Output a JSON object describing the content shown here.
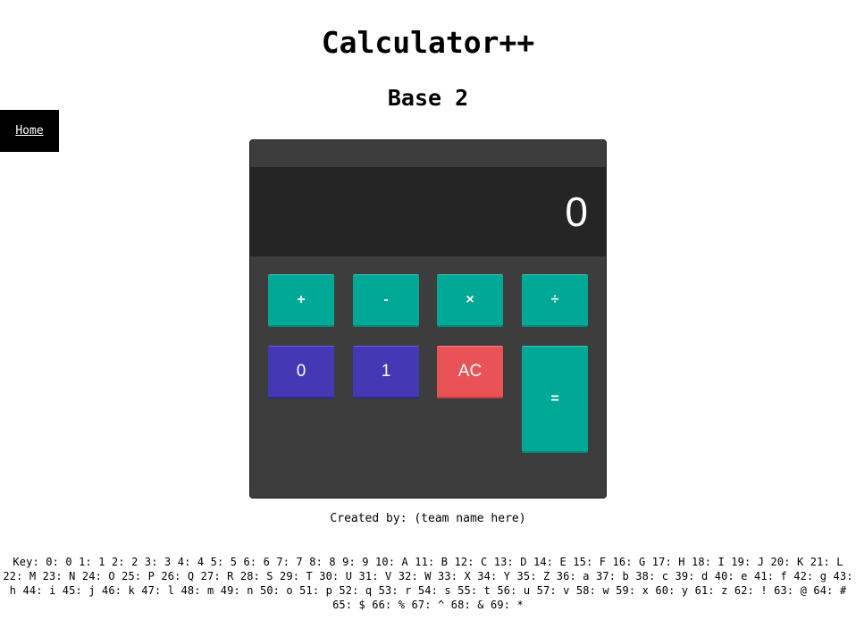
{
  "header": {
    "title": "Calculator++",
    "subtitle": "Base 2"
  },
  "nav": {
    "home_label": "Home"
  },
  "calculator": {
    "display_value": "0",
    "operators": {
      "add": "+",
      "subtract": "-",
      "multiply": "×",
      "divide": "÷"
    },
    "digits": {
      "zero": "0",
      "one": "1"
    },
    "clear_label": "AC",
    "equals_label": "=",
    "colors": {
      "body": "#3d3d3d",
      "display": "#252525",
      "operator": "#00a896",
      "digit": "#4438b5",
      "clear": "#e95357"
    }
  },
  "footer": {
    "credit": "Created by: (team name here)",
    "key_legend": "Key: 0: 0 1: 1 2: 2 3: 3 4: 4 5: 5 6: 6 7: 7 8: 8 9: 9 10: A 11: B 12: C 13: D 14: E 15: F 16: G 17: H 18: I 19: J 20: K 21: L 22: M 23: N 24: O 25: P 26: Q 27: R 28: S 29: T 30: U 31: V 32: W 33: X 34: Y 35: Z 36: a 37: b 38: c 39: d 40: e 41: f 42: g 43: h 44: i 45: j 46: k 47: l 48: m 49: n 50: o 51: p 52: q 53: r 54: s 55: t 56: u 57: v 58: w 59: x 60: y 61: z 62: ! 63: @ 64: # 65: $ 66: % 67: ^ 68: & 69: *"
  }
}
